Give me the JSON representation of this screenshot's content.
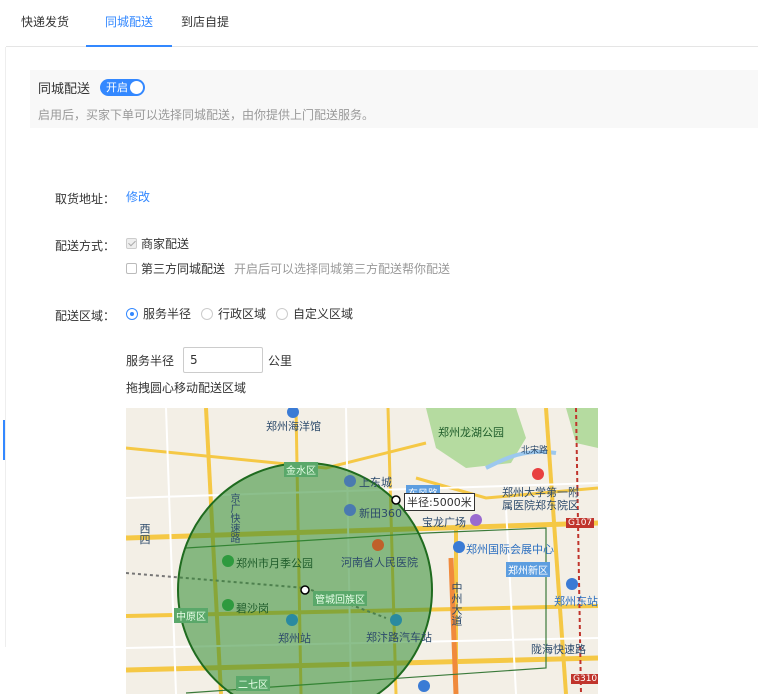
{
  "tabs": [
    {
      "label": "快递发货"
    },
    {
      "label": "同城配送"
    },
    {
      "label": "到店自提"
    }
  ],
  "panel": {
    "title": "同城配送",
    "toggle_label": "开启",
    "description": "启用后，买家下单可以选择同城配送，由你提供上门配送服务。"
  },
  "pickup": {
    "label": "取货地址：",
    "link": "修改"
  },
  "delivery_method": {
    "label": "配送方式：",
    "options": [
      {
        "label": "商家配送",
        "checked": true
      },
      {
        "label": "第三方同城配送",
        "checked": false,
        "hint": "开启后可以选择同城第三方配送帮你配送"
      }
    ]
  },
  "delivery_area": {
    "label": "配送区域：",
    "options": [
      {
        "label": "服务半径",
        "selected": true
      },
      {
        "label": "行政区域",
        "selected": false
      },
      {
        "label": "自定义区域",
        "selected": false
      }
    ]
  },
  "radius": {
    "label": "服务半径",
    "value": "5",
    "unit": "公里",
    "drag_hint": "拖拽圆心移动配送区域"
  },
  "map": {
    "radius_tag": "半径:5000米",
    "labels": {
      "hall": "郑州海洋馆",
      "lake_park": "郑州龙湖公园",
      "beizhu": "北宋路",
      "shangcheng": "上东城",
      "jinshui": "金水区",
      "xintian": "新田360",
      "dongfeng": "东风路",
      "baolong": "宝龙广场",
      "hospital1": "郑州大学第一附",
      "hospital1b": "属医院郑东院区",
      "xisi": "西四",
      "yuehu": "郑州市月季公园",
      "henan_hosp": "河南省人民医院",
      "expo": "郑州国际会展中心",
      "zhengdong": "郑州新区",
      "zhongzhou": "中州大道",
      "east_station": "郑州东站",
      "bisha": "碧沙岗",
      "zhongyuan": "中原区",
      "guancheng": "管城回族区",
      "zz_station": "郑州站",
      "bus_station": "郑汴路汽车站",
      "erqi": "二七区",
      "longhai": "陇海快速路",
      "g107": "G107",
      "g310": "G310",
      "jingguang": "京广快速路"
    }
  }
}
